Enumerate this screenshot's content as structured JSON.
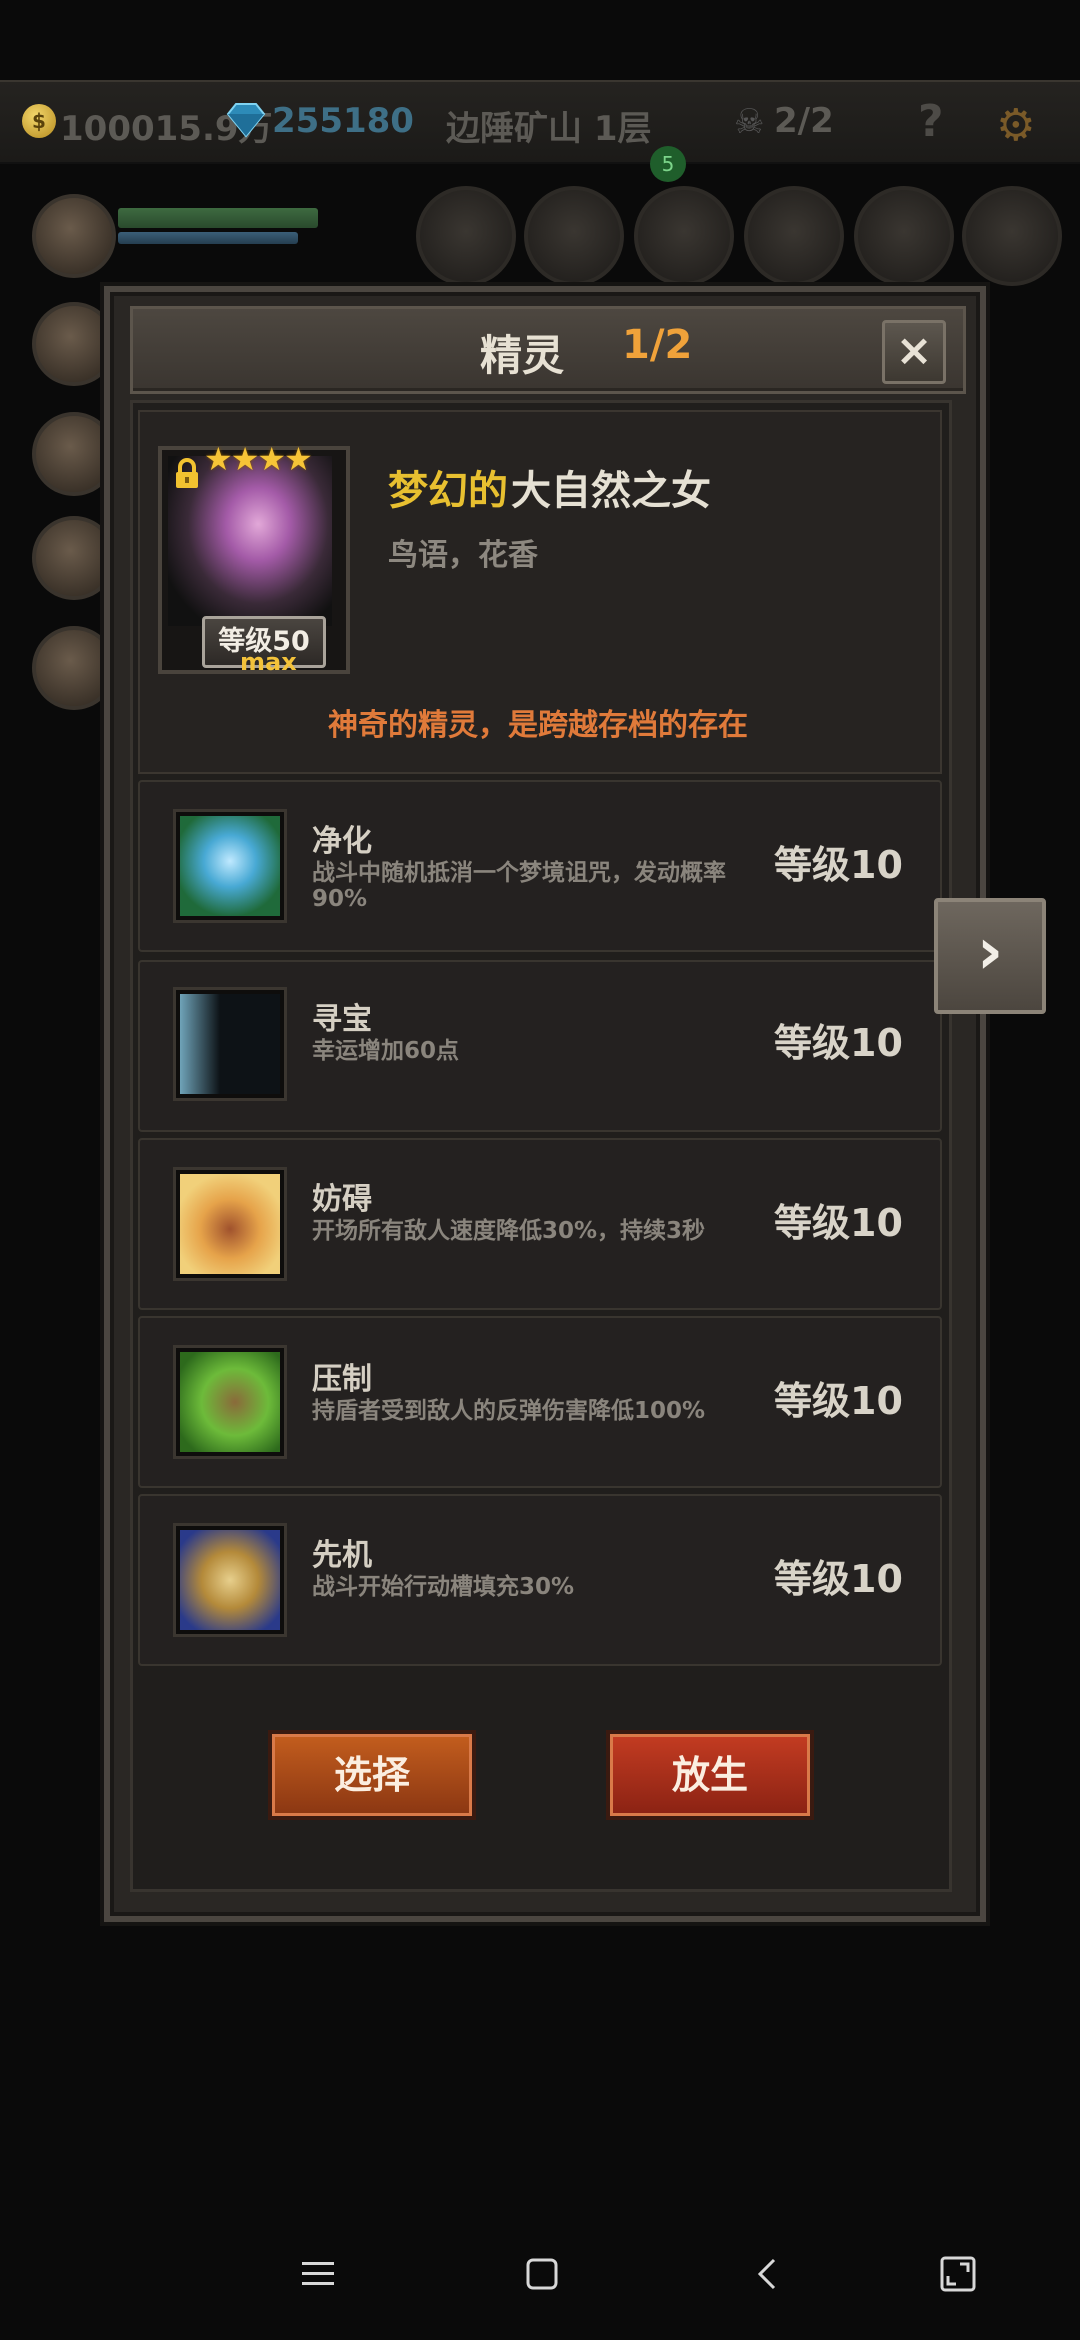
{
  "hud": {
    "gold": "100015.9万",
    "gems": "255180",
    "location": "边陲矿山 1层",
    "party": "2/2",
    "help": "?",
    "notif_count": "5"
  },
  "dialog": {
    "title": "精灵",
    "count": "1/2",
    "close": "×",
    "next": "›"
  },
  "hero": {
    "stars": "★★★★",
    "level_badge": "等级50",
    "level_max": "max",
    "name_prefix": "梦幻的",
    "name_main": "大自然之女",
    "subtitle": "鸟语，花香",
    "description": "神奇的精灵，是跨越存档的存在"
  },
  "skills": [
    {
      "name": "净化",
      "desc": "战斗中随机抵消一个梦境诅咒，发动概率90%",
      "level": "等级10",
      "icon": "blue-flower-icon"
    },
    {
      "name": "寻宝",
      "desc": "幸运增加60点",
      "level": "等级10",
      "icon": "silhouette-stars-icon"
    },
    {
      "name": "妨碍",
      "desc": "开场所有敌人速度降低30%，持续3秒",
      "level": "等级10",
      "icon": "chained-boot-icon"
    },
    {
      "name": "压制",
      "desc": "持盾者受到敌人的反弹伤害降低100%",
      "level": "等级10",
      "icon": "grass-claw-icon"
    },
    {
      "name": "先机",
      "desc": "战斗开始行动槽填充30%",
      "level": "等级10",
      "icon": "leopard-icon"
    }
  ],
  "buttons": {
    "select": "选择",
    "release": "放生"
  },
  "colors": {
    "accent_gold": "#e8c030",
    "count_orange": "#f0a23a",
    "desc_orange": "#e07a3a",
    "button_red": "#b33a1f"
  }
}
